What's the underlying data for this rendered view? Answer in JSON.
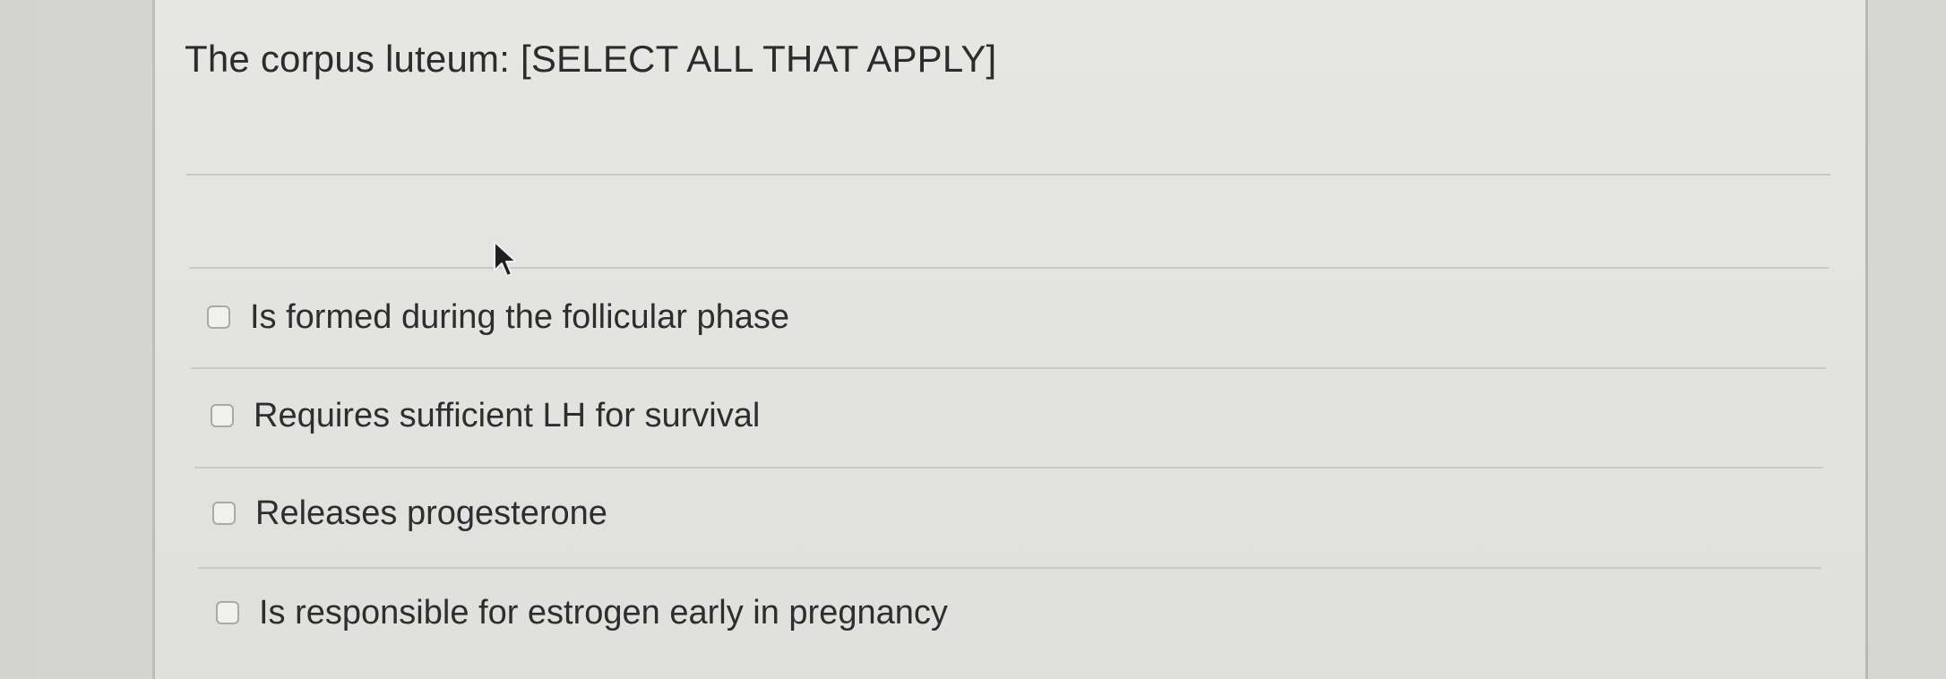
{
  "question": {
    "text": "The corpus luteum: [SELECT ALL THAT APPLY]"
  },
  "answers": [
    {
      "label": "Is formed during the follicular phase",
      "checked": false
    },
    {
      "label": "Requires sufficient LH for survival",
      "checked": false
    },
    {
      "label": "Releases progesterone",
      "checked": false
    },
    {
      "label": "Is responsible for estrogen early in pregnancy",
      "checked": false
    }
  ],
  "cursor": {
    "icon": "mouse-pointer-icon"
  },
  "colors": {
    "card_background": "#e4e4e2",
    "text": "#2c2c2c",
    "checkbox_border": "#a9a9a7"
  }
}
